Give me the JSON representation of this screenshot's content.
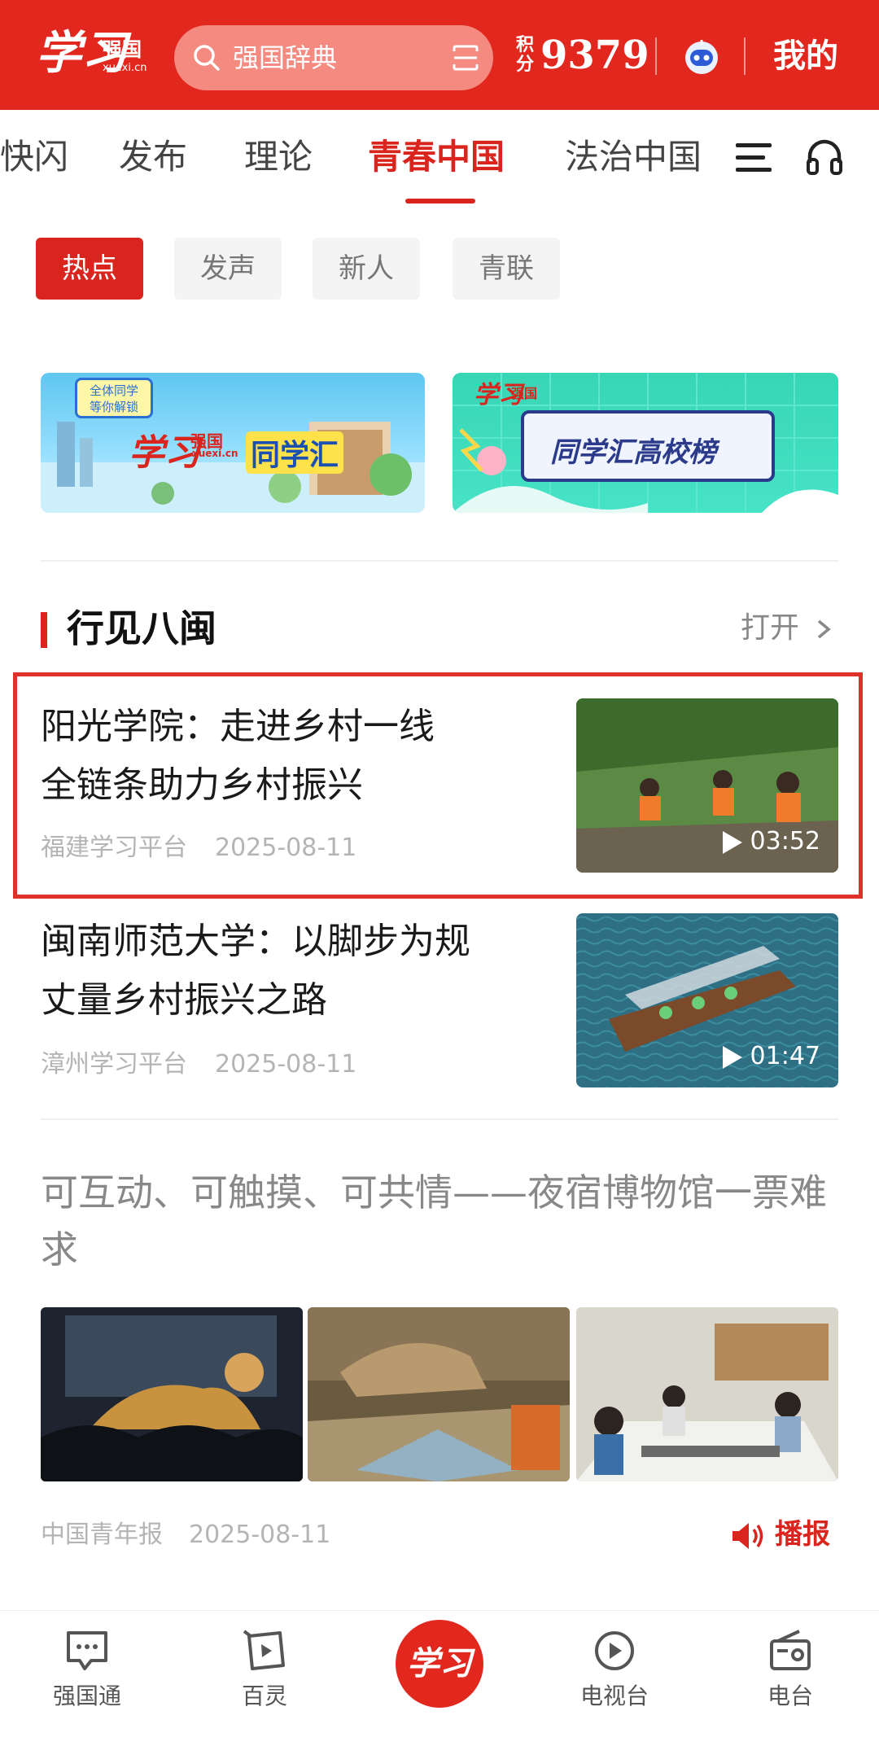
{
  "header": {
    "logo_brand": "学习",
    "logo_sub": "强国",
    "logo_domain": "xuexi.cn",
    "search_placeholder": "强国辞典",
    "points_label": "积分",
    "points_value": "9379",
    "my_label": "我的",
    "colors": {
      "brand_red": "#e2281e"
    }
  },
  "channels": {
    "items": [
      "快闪",
      "发布",
      "理论",
      "青春中国",
      "法治中国"
    ],
    "active": "青春中国"
  },
  "subtabs": {
    "items": [
      "热点",
      "发声",
      "新人",
      "青联"
    ],
    "active": "热点"
  },
  "banners": {
    "b1": {
      "bubble_line1": "全体同学",
      "bubble_line2": "等你解锁",
      "logo": "学习",
      "logo_sub": "强国",
      "logo_domain": "xuexi.cn",
      "text": "同学汇"
    },
    "b2": {
      "logo": "学习",
      "logo_sub": "强国",
      "text": "同学汇高校榜"
    }
  },
  "section": {
    "title": "行见八闽",
    "open_label": "打开"
  },
  "articles": [
    {
      "title_line1": "阳光学院：走进乡村一线",
      "title_line2": "全链条助力乡村振兴",
      "source": "福建学习平台",
      "date": "2025-08-11",
      "duration": "03:52"
    },
    {
      "title_line1": "闽南师范大学：以脚步为规",
      "title_line2": "丈量乡村振兴之路",
      "source": "漳州学习平台",
      "date": "2025-08-11",
      "duration": "01:47"
    }
  ],
  "article3": {
    "title": "可互动、可触摸、可共情——夜宿博物馆一票难求",
    "source": "中国青年报",
    "date": "2025-08-11",
    "broadcast_label": "播报"
  },
  "bottom_nav": {
    "items": [
      "强国通",
      "百灵",
      "学习",
      "电视台",
      "电台"
    ]
  }
}
